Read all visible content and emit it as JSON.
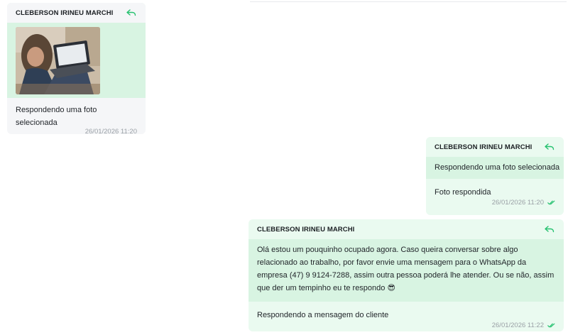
{
  "messages": [
    {
      "direction": "incoming",
      "quoted_author": "CLEBERSON IRINEU MARCHI",
      "quoted_media": "photo-woman-laptop",
      "text": "Respondendo uma foto selecionada",
      "timestamp": "26/01/2026 11:20"
    },
    {
      "direction": "outgoing",
      "quoted_author": "CLEBERSON IRINEU MARCHI",
      "quoted_text": "Respondendo uma foto selecionada",
      "text": "Foto respondida",
      "timestamp": "26/01/2026 11:20",
      "status": "read"
    },
    {
      "direction": "outgoing",
      "quoted_author": "CLEBERSON IRINEU MARCHI",
      "quoted_text": "Olá estou um pouquinho ocupado agora. Caso queira conversar sobre algo relacionado ao trabalho, por favor envie uma mensagem para o WhatsApp da empresa (47) 9 9124-7288, assim outra pessoa poderá lhe atender. Ou se não, assim que der um tempinho eu te respondo 😎",
      "text": "Respondendo a mensagem do cliente",
      "timestamp": "26/01/2026 11:22",
      "status": "read"
    }
  ],
  "colors": {
    "incoming_bg": "#f5f6f8",
    "outgoing_bg": "#eafaf0",
    "quote_bg": "#d8f4e2",
    "accent": "#25c16f",
    "timestamp": "#9aa0a6"
  },
  "icons": {
    "reply": "reply-arrow-icon",
    "read": "double-check-icon"
  }
}
